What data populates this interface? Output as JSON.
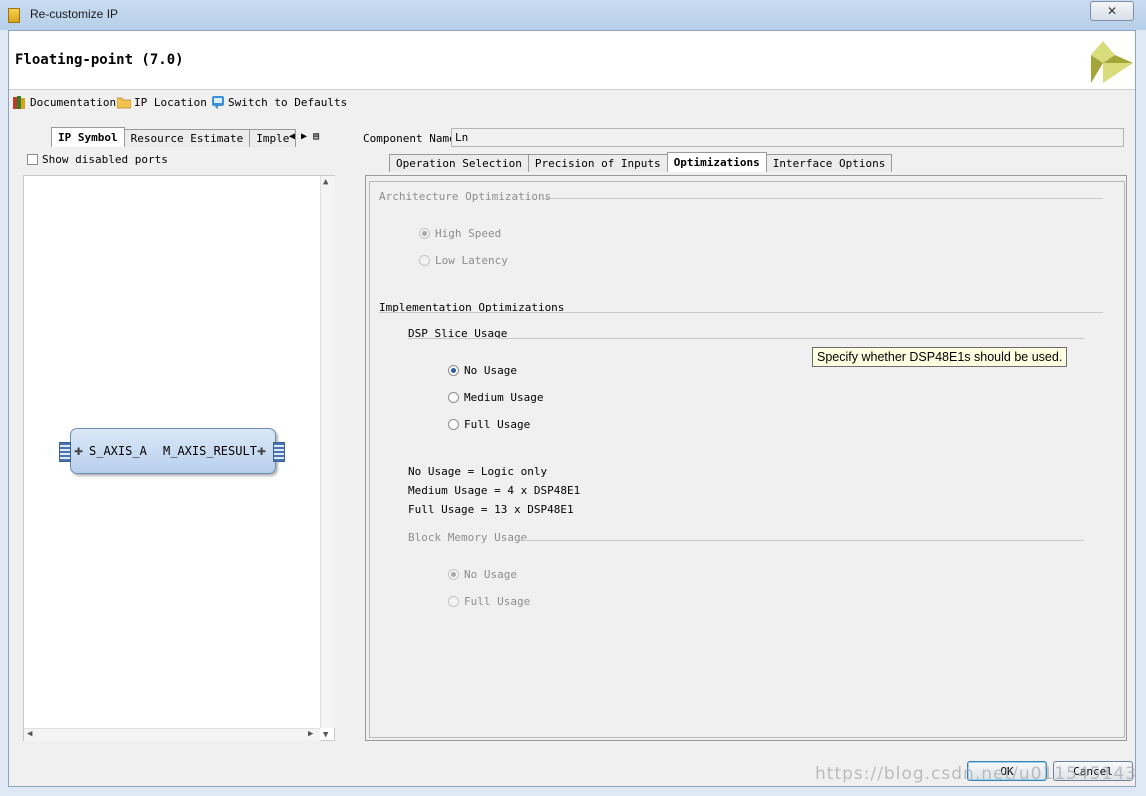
{
  "window": {
    "title": "Re-customize IP",
    "close_symbol": "✕"
  },
  "header": {
    "ip_title": "Floating-point (7.0)"
  },
  "toolbar": {
    "documentation": "Documentation",
    "ip_location": "IP Location",
    "switch_defaults": "Switch to Defaults"
  },
  "left_panel": {
    "tabs": [
      "IP Symbol",
      "Resource Estimate",
      "Imple"
    ],
    "show_disabled_label": "Show disabled ports",
    "symbol": {
      "left_port": "S_AXIS_A",
      "right_port": "M_AXIS_RESULT"
    }
  },
  "right_panel": {
    "component_label": "Component Name",
    "component_value": "Ln",
    "tabs": [
      "Operation Selection",
      "Precision of Inputs",
      "Optimizations",
      "Interface Options"
    ],
    "architecture": {
      "title": "Architecture Optimizations",
      "options": [
        "High Speed",
        "Low Latency"
      ]
    },
    "implementation": {
      "title": "Implementation Optimizations",
      "dsp": {
        "title": "DSP Slice Usage",
        "options": [
          "No Usage",
          "Medium Usage",
          "Full Usage"
        ],
        "notes": [
          "No Usage = Logic only",
          "Medium Usage = 4 x DSP48E1",
          "Full Usage = 13 x DSP48E1"
        ]
      },
      "bram": {
        "title": "Block Memory Usage",
        "options": [
          "No Usage",
          "Full Usage"
        ]
      }
    },
    "tooltip": "Specify whether DSP48E1s should be used."
  },
  "buttons": {
    "ok": "OK",
    "cancel": "Cancel"
  },
  "watermark": "https://blog.csdn.net/u011545143",
  "colors": {
    "accent": "#2a5aa8",
    "logo_yellow": "#d8dc7a",
    "logo_olive": "#a4a63a"
  }
}
